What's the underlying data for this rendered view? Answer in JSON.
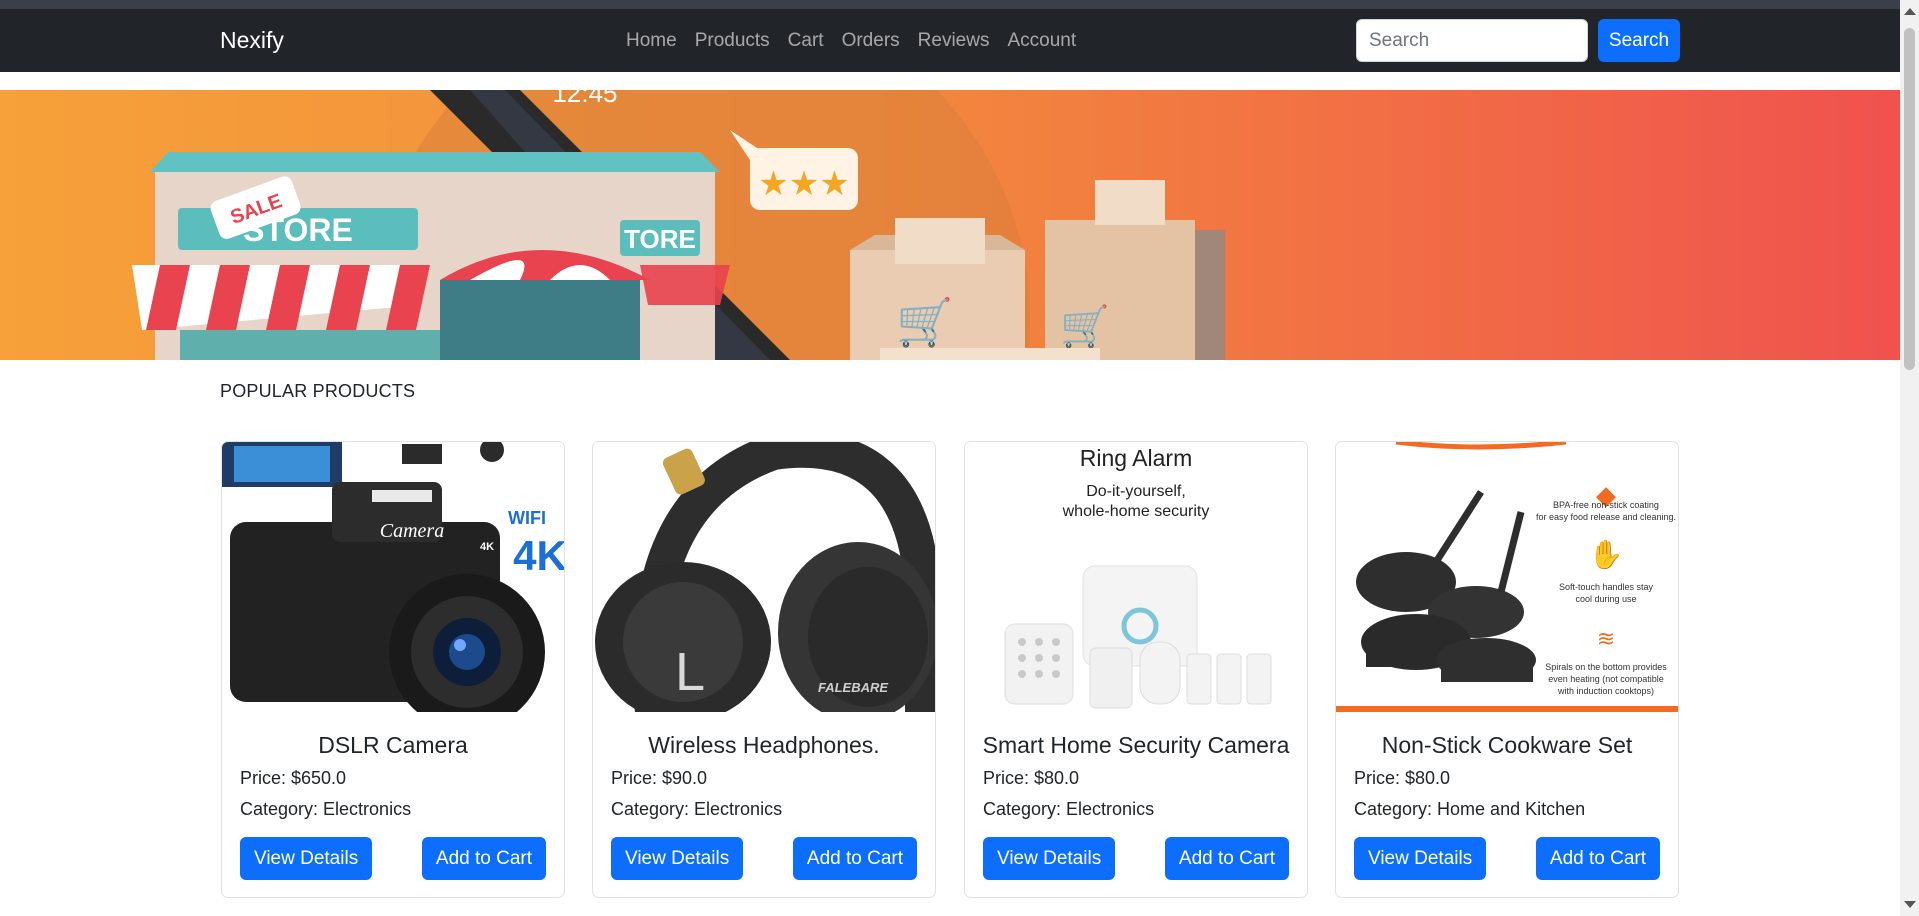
{
  "navbar": {
    "brand": "Nexify",
    "links": [
      "Home",
      "Products",
      "Cart",
      "Orders",
      "Reviews",
      "Account"
    ],
    "search_placeholder": "Search",
    "search_button": "Search"
  },
  "hero": {
    "store_sign_main": "STORE",
    "store_sign_side": "TORE",
    "sale_tag": "SALE",
    "clock": "12:45"
  },
  "section": {
    "title": "POPULAR PRODUCTS"
  },
  "products": [
    {
      "name": "DSLR Camera",
      "price": "Price: $650.0",
      "category": "Category: Electronics",
      "image_text": [
        "Camera",
        "4K",
        "WIFI",
        "4K"
      ]
    },
    {
      "name": "Wireless Headphones.",
      "price": "Price: $90.0",
      "category": "Category: Electronics",
      "image_text": [
        "L",
        "FALEBARE"
      ]
    },
    {
      "name": "Smart Home Security Camera",
      "price": "Price: $80.0",
      "category": "Category: Electronics",
      "image_text": [
        "Ring Alarm",
        "Do-it-yourself,",
        "whole-home security"
      ]
    },
    {
      "name": "Non-Stick Cookware Set",
      "price": "Price: $80.0",
      "category": "Category: Home and Kitchen",
      "image_text": [
        "BPA-free non-stick coating",
        "for easy food release and cleaning.",
        "Soft-touch handles stay",
        "cool during use",
        "Spirals on the bottom provides",
        "even heating (not compatible",
        "with induction cooktops)"
      ]
    }
  ],
  "buttons": {
    "view_details": "View Details",
    "add_to_cart": "Add to Cart"
  },
  "colors": {
    "navbar": "#212529",
    "primary": "#0d6efd",
    "hero_left": "#f6a13a",
    "hero_right": "#f0524e"
  },
  "icons": [
    "star-icon",
    "shopping-cart-icon"
  ]
}
